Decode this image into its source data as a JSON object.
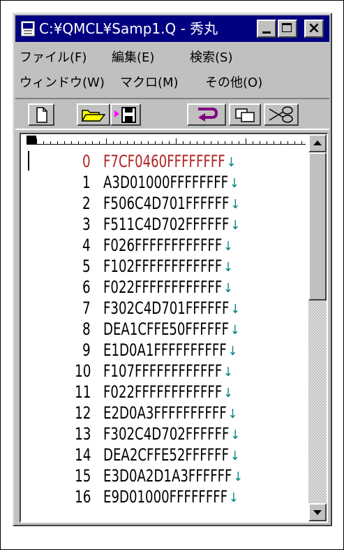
{
  "window": {
    "title": "C:¥QMCL¥Samp1.Q - 秀丸",
    "close_glyph": "×"
  },
  "menus": {
    "row1": [
      "ファイル(F)",
      "編集(E)",
      "検索(S)"
    ],
    "row2": [
      "ウィンドウ(W)",
      "マクロ(M)",
      "その他(O)"
    ]
  },
  "toolbar": {
    "icons": [
      "new-file-icon",
      "open-folder-icon",
      "save-icon",
      "undo-icon",
      "copy-icon",
      "cut-icon"
    ]
  },
  "editor": {
    "return_glyph": "↓",
    "current_line": 0,
    "lines": [
      {
        "num": "0",
        "text": "F7CF0460FFFFFFFF"
      },
      {
        "num": "1",
        "text": "A3D01000FFFFFFFF"
      },
      {
        "num": "2",
        "text": "F506C4D701FFFFFF"
      },
      {
        "num": "3",
        "text": "F511C4D702FFFFFF"
      },
      {
        "num": "4",
        "text": "F026FFFFFFFFFFFF"
      },
      {
        "num": "5",
        "text": "F102FFFFFFFFFFFF"
      },
      {
        "num": "6",
        "text": "F022FFFFFFFFFFFF"
      },
      {
        "num": "7",
        "text": "F302C4D701FFFFFF"
      },
      {
        "num": "8",
        "text": "DEA1CFFE50FFFFFF"
      },
      {
        "num": "9",
        "text": "E1D0A1FFFFFFFFFF"
      },
      {
        "num": "10",
        "text": "F107FFFFFFFFFFFF"
      },
      {
        "num": "11",
        "text": "F022FFFFFFFFFFFF"
      },
      {
        "num": "12",
        "text": "E2D0A3FFFFFFFFFF"
      },
      {
        "num": "13",
        "text": "F302C4D702FFFFFF"
      },
      {
        "num": "14",
        "text": "DEA2CFFE52FFFFFF"
      },
      {
        "num": "15",
        "text": "E3D0A2D1A3FFFFFF"
      },
      {
        "num": "16",
        "text": "E9D01000FFFFFFFF"
      }
    ]
  },
  "colors": {
    "title_bar": "#000080",
    "current_line_text": "#b22222",
    "return_mark": "#008080",
    "chrome": "#c0c0c0"
  }
}
